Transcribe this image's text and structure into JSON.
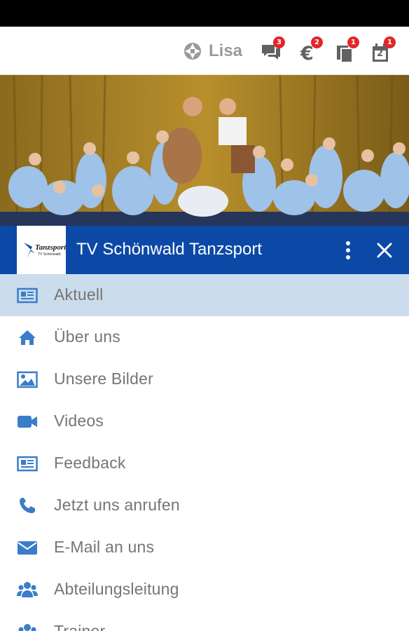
{
  "topbar": {
    "user_name": "Lisa",
    "badges": {
      "messages": "3",
      "payments": "2",
      "documents": "1",
      "calendar": "1"
    },
    "calendar_day": "2"
  },
  "header": {
    "club_name": "TV Schönwald Tanzsport",
    "logo_text": "Tanzsport",
    "logo_subtext": "TV Schönwald"
  },
  "nav": {
    "items": [
      {
        "label": "Aktuell",
        "icon": "newspaper-icon",
        "active": true
      },
      {
        "label": "Über uns",
        "icon": "home-icon"
      },
      {
        "label": "Unsere Bilder",
        "icon": "image-icon"
      },
      {
        "label": "Videos",
        "icon": "video-camera-icon"
      },
      {
        "label": "Feedback",
        "icon": "newspaper-icon"
      },
      {
        "label": "Jetzt uns anrufen",
        "icon": "phone-icon"
      },
      {
        "label": "E-Mail an uns",
        "icon": "envelope-icon"
      },
      {
        "label": "Abteilungsleitung",
        "icon": "users-icon"
      },
      {
        "label": "Trainer",
        "icon": "users-icon"
      }
    ]
  },
  "colors": {
    "header_blue": "#0c49a7",
    "icon_blue": "#3a7dc9",
    "active_row": "#cbdcec",
    "badge_red": "#e3262a"
  }
}
